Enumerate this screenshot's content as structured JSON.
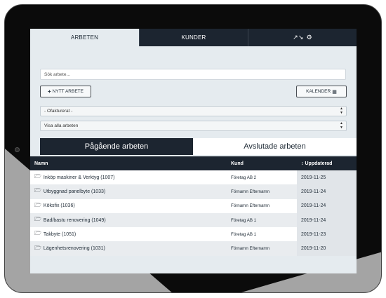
{
  "nav_tabs": [
    {
      "label": "ARBETEN",
      "active": true
    },
    {
      "label": "KUNDER",
      "active": false
    }
  ],
  "nav_icons": {
    "icon1": "↗↘",
    "icon2": "⚙",
    "names": [
      "chart-trend-icon",
      "gear-icon"
    ]
  },
  "search": {
    "placeholder": "Sök arbete..."
  },
  "buttons": {
    "new_job_icon": "+",
    "new_job": "NYTT ARBETE",
    "calendar": "KALENDER",
    "calendar_icon": "▦"
  },
  "filters": [
    {
      "selected": "- Ofakturerat -"
    },
    {
      "selected": "Visa alla arbeten"
    }
  ],
  "job_tabs": [
    {
      "label": "Pågående arbeten",
      "active": true
    },
    {
      "label": "Avslutade arbeten",
      "active": false
    }
  ],
  "table": {
    "headers": {
      "name": "Namn",
      "customer": "Kund",
      "sort_icon": "↕",
      "updated": "Uppdaterad"
    },
    "rows": [
      {
        "name": "Inköp maskiner & Verktyg (1007)",
        "customer": "Företag AB 2",
        "updated": "2019-11-25"
      },
      {
        "name": "Utbyggnad  panelbyte (1033)",
        "customer": "Förnamn Efternamn",
        "updated": "2019-11-24"
      },
      {
        "name": "Köksfix  (1036)",
        "customer": "Förnamn Efternamn",
        "updated": "2019-11-24"
      },
      {
        "name": "Bad/bastu renovering   (1049)",
        "customer": "Företag AB 1",
        "updated": "2019-11-24"
      },
      {
        "name": "Takbyte   (1051)",
        "customer": "Företag AB 1",
        "updated": "2019-11-23"
      },
      {
        "name": "Lägenhetsrenovering (1031)",
        "customer": "Förnamn Efternamn",
        "updated": "2019-11-20"
      }
    ]
  },
  "colors": {
    "dark": "#1c2530",
    "screen_bg": "#e5ebef",
    "frame": "#0b0b0b"
  }
}
